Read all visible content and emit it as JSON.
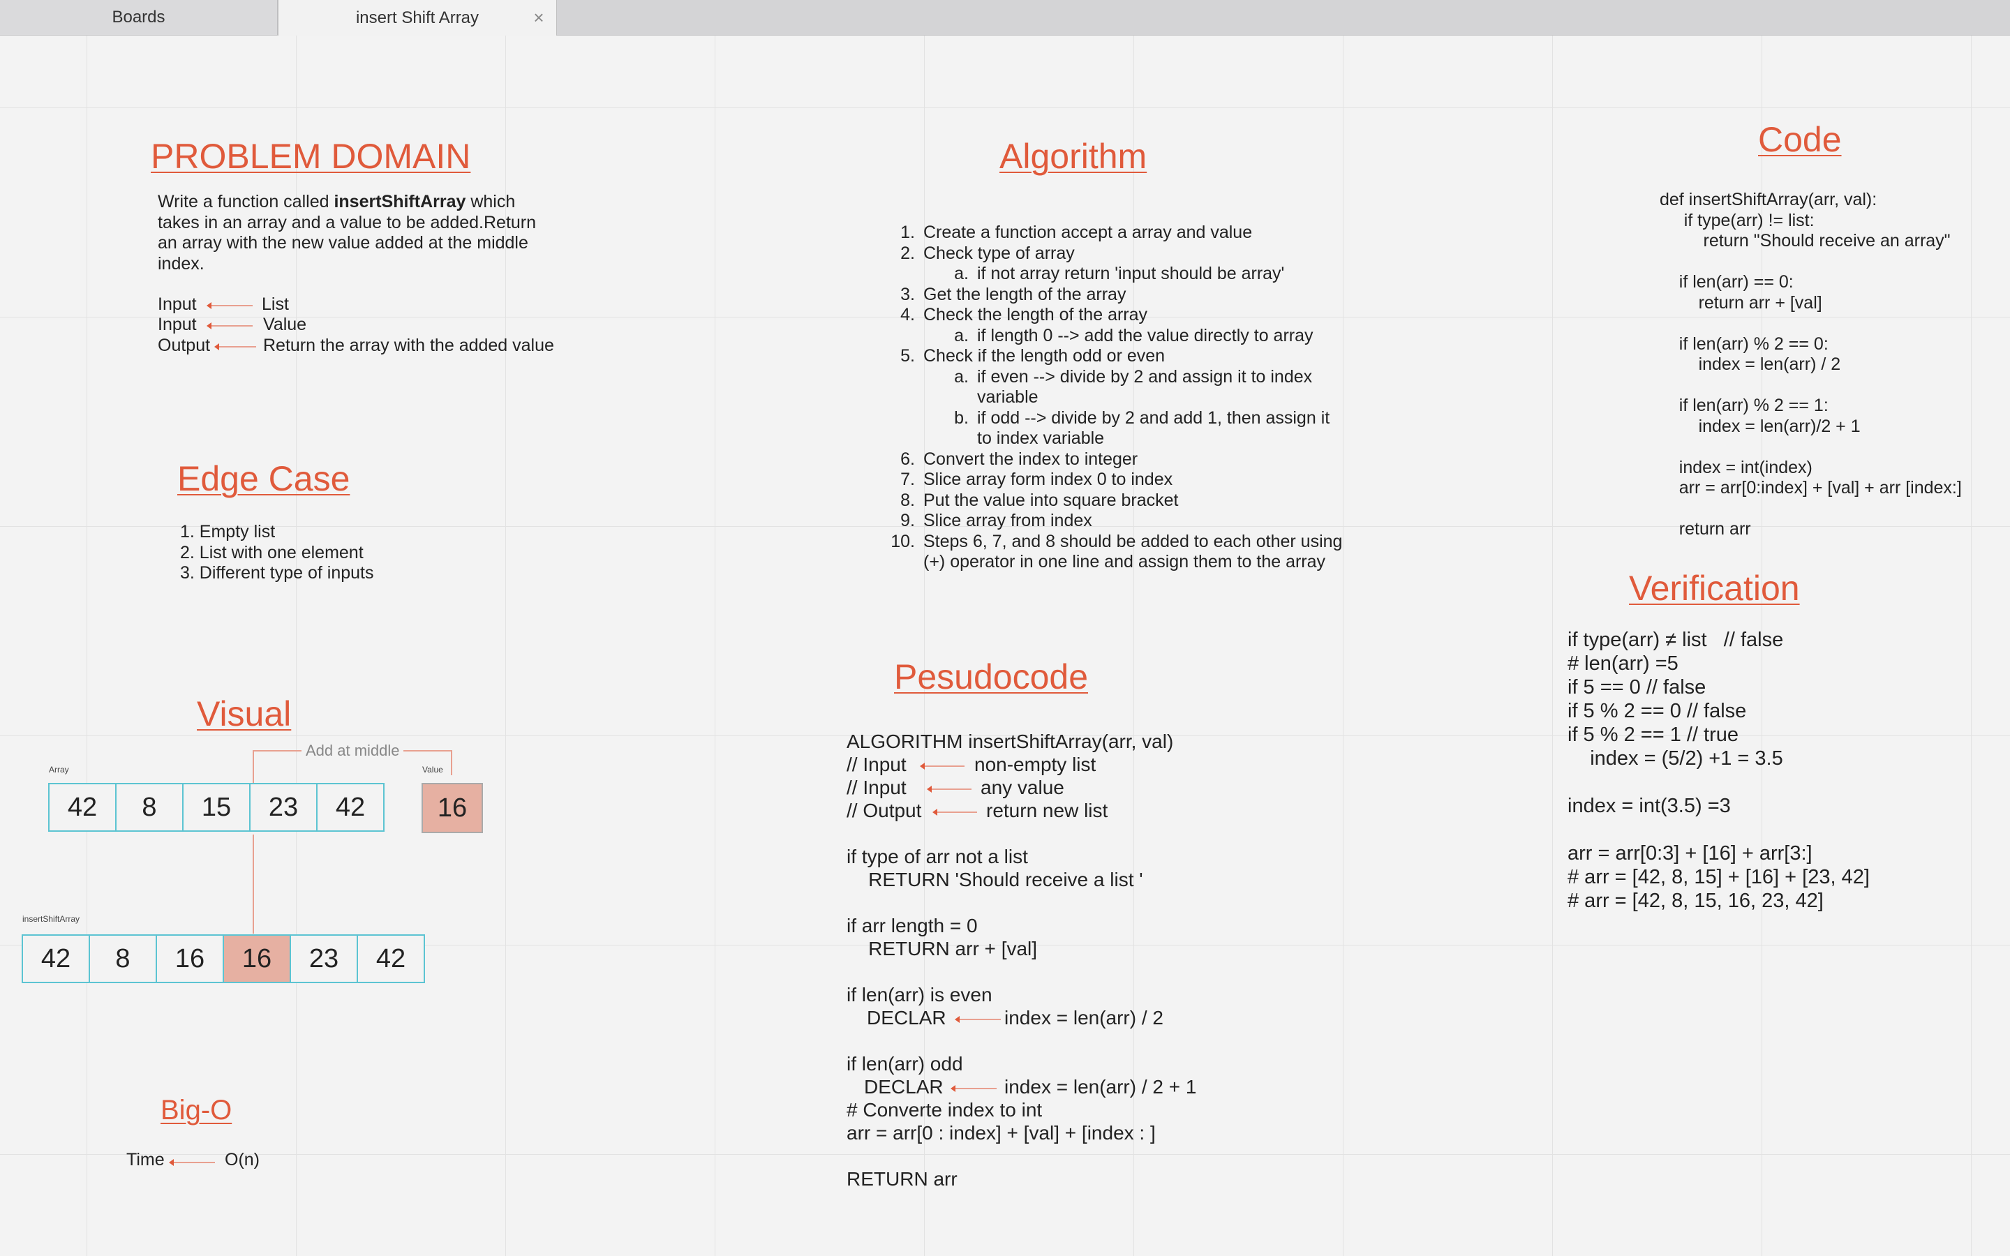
{
  "tabs": [
    {
      "label": "Boards"
    },
    {
      "label": "insert Shift Array"
    }
  ],
  "sections": {
    "problem_domain": "PROBLEM DOMAIN",
    "edge_case": "Edge Case",
    "visual": "Visual",
    "big_o": "Big-O",
    "algorithm": "Algorithm",
    "pseudocode": "Pesudocode",
    "code": "Code",
    "verification": "Verification"
  },
  "problem": {
    "desc_pre": "Write a function called ",
    "desc_bold": "insertShiftArray",
    "desc_post": " which",
    "desc_lines": [
      "takes in an array and a value to be added.Return",
      "an array with the new value added at the middle",
      "index."
    ],
    "io": [
      {
        "label": "Input",
        "value": "List"
      },
      {
        "label": "Input",
        "value": "Value"
      },
      {
        "label": "Output",
        "value": "Return the array with the added value"
      }
    ]
  },
  "edge_cases": [
    "Empty list",
    "List with one element",
    "Different type of inputs"
  ],
  "visual": {
    "array_label": "Array",
    "value_label": "Value",
    "result_label": "insertShiftArray",
    "add_label": "Add at middle",
    "array": [
      "42",
      "8",
      "15",
      "23",
      "42"
    ],
    "value": "16",
    "result": [
      "42",
      "8",
      "16",
      "16",
      "23",
      "42"
    ],
    "highlight_index": 3
  },
  "big_o": {
    "label": "Time",
    "value": "O(n)"
  },
  "algorithm": [
    {
      "n": "1.",
      "text": "Create a function accept a array and value"
    },
    {
      "n": "2.",
      "text": "Check type of array"
    },
    {
      "n": "a.",
      "text": "if not array return 'input should be array'",
      "sub": true
    },
    {
      "n": "3.",
      "text": "Get the length of the array"
    },
    {
      "n": "4.",
      "text": "Check the length of the array"
    },
    {
      "n": "a.",
      "text": "if length 0 --> add the value directly to array",
      "sub": true
    },
    {
      "n": "5.",
      "text": "Check if the length odd or even"
    },
    {
      "n": "a.",
      "text": "if even --> divide by 2 and assign it to index",
      "sub": true
    },
    {
      "n": "",
      "text": "variable",
      "sub": true
    },
    {
      "n": "b.",
      "text": "if odd --> divide by 2 and add 1, then assign it",
      "sub": true
    },
    {
      "n": "",
      "text": "to index variable",
      "sub": true
    },
    {
      "n": "6.",
      "text": "Convert the index to integer"
    },
    {
      "n": "7.",
      "text": "Slice array form index 0 to index"
    },
    {
      "n": "8.",
      "text": "Put the value into square bracket"
    },
    {
      "n": "9.",
      "text": "Slice array from index"
    },
    {
      "n": "10.",
      "text": "Steps 6, 7, and 8 should be added to each other using"
    },
    {
      "n": "",
      "text": "(+) operator in one line and assign them to the array"
    }
  ],
  "pseudocode": {
    "header": "ALGORITHM insertShiftArray(arr, val)",
    "io": [
      {
        "label": "// Input",
        "value": "non-empty list"
      },
      {
        "label": "// Input",
        "value": "any value"
      },
      {
        "label": "// Output",
        "value": "return new list"
      }
    ],
    "block1": "if type of arr not a list\n    RETURN 'Should receive a list '\n\nif arr length = 0\n    RETURN arr + [val]\n\nif len(arr) is even",
    "declar1": "DECLAR",
    "declar1_value": "index = len(arr) / 2",
    "odd_line": "if len(arr) odd",
    "declar2": "DECLAR",
    "declar2_value": "index = len(arr) / 2 + 1",
    "block2": "# Converte index to int\narr = arr[0 : index] + [val] + [index : ]\n\nRETURN arr"
  },
  "code": "def insertShiftArray(arr, val):\n     if type(arr) != list:\n         return \"Should receive an array\"\n\n    if len(arr) == 0:\n        return arr + [val]\n\n    if len(arr) % 2 == 0:\n        index = len(arr) / 2\n\n    if len(arr) % 2 == 1:\n        index = len(arr)/2 + 1\n\n    index = int(index)\n    arr = arr[0:index] + [val] + arr [index:]\n\n    return arr",
  "verification": "if type(arr) ≠ list   // false\n# len(arr) =5\nif 5 == 0 // false\nif 5 % 2 == 0 // false\nif 5 % 2 == 1 // true\n    index = (5/2) +1 = 3.5\n\nindex = int(3.5) =3\n\narr = arr[0:3] + [16] + arr[3:]\n# arr = [42, 8, 15] + [16] + [23, 42]\n# arr = [42, 8, 15, 16, 23, 42]"
}
